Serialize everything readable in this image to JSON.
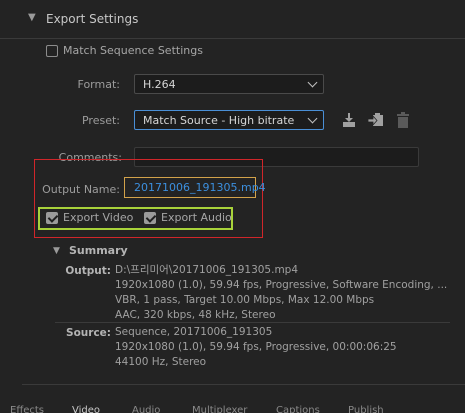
{
  "section": {
    "title": "Export Settings"
  },
  "match_sequence": {
    "label": "Match Sequence Settings",
    "checked": false
  },
  "format": {
    "label": "Format:",
    "value": "H.264"
  },
  "preset": {
    "label": "Preset:",
    "value": "Match Source - High bitrate"
  },
  "comments": {
    "label": "Comments:",
    "value": ""
  },
  "output_name": {
    "label": "Output Name:",
    "value": "20171006_191305.mp4"
  },
  "export_video": {
    "label": "Export Video",
    "checked": true
  },
  "export_audio": {
    "label": "Export Audio",
    "checked": true
  },
  "summary": {
    "title": "Summary",
    "output_label": "Output:",
    "output_lines": [
      "D:\\프리미어\\20171006_191305.mp4",
      "1920x1080 (1.0), 59.94 fps, Progressive, Software Encoding, ...",
      "VBR, 1 pass, Target 10.00 Mbps, Max 12.00 Mbps",
      "AAC, 320 kbps, 48 kHz, Stereo"
    ],
    "source_label": "Source:",
    "source_lines": [
      "Sequence, 20171006_191305",
      "1920x1080 (1.0), 59.94 fps, Progressive, 00:00:06:25",
      "44100 Hz, Stereo"
    ]
  },
  "tabs": [
    "Effects",
    "Video",
    "Audio",
    "Multiplexer",
    "Captions",
    "Publish"
  ],
  "icons": {
    "save_preset": "save-preset-icon",
    "import_preset": "import-preset-icon",
    "delete_preset": "delete-preset-icon"
  }
}
